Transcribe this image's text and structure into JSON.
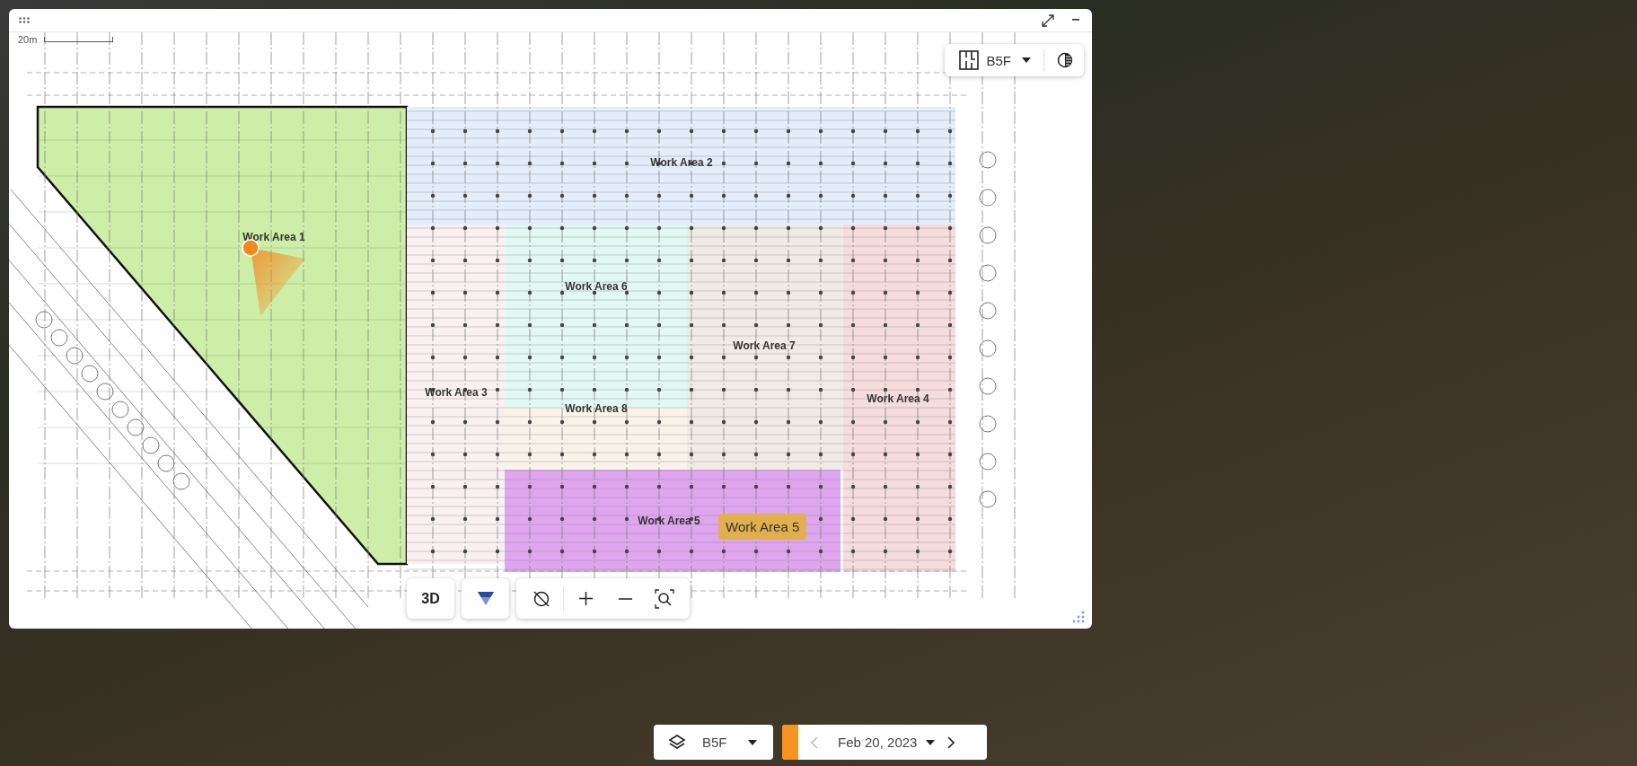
{
  "panel": {
    "scale_label": "20m",
    "floor_selector": {
      "floor": "B5F"
    },
    "work_areas": [
      {
        "label": "Work Area 1",
        "color": "#cdeea8",
        "selected": true
      },
      {
        "label": "Work Area 2",
        "color": "#e4edfa",
        "selected": false
      },
      {
        "label": "Work Area 3",
        "color": "#faf0f1",
        "selected": false
      },
      {
        "label": "Work Area 4",
        "color": "#f6dcdc",
        "selected": false
      },
      {
        "label": "Work Area 5",
        "color": "#dfa6ef",
        "selected": false
      },
      {
        "label": "Work Area 6",
        "color": "#e2f8f3",
        "selected": false
      },
      {
        "label": "Work Area 7",
        "color": "#f1ebe5",
        "selected": false
      },
      {
        "label": "Work Area 8",
        "color": "#faf3ea",
        "selected": false
      }
    ],
    "tooltip": "Work Area 5",
    "toolbar": {
      "view_button": "3D"
    }
  },
  "bottom_bar": {
    "floor": "B5F",
    "date": "Feb 20, 2023",
    "prev_disabled": true,
    "next_disabled": false
  }
}
